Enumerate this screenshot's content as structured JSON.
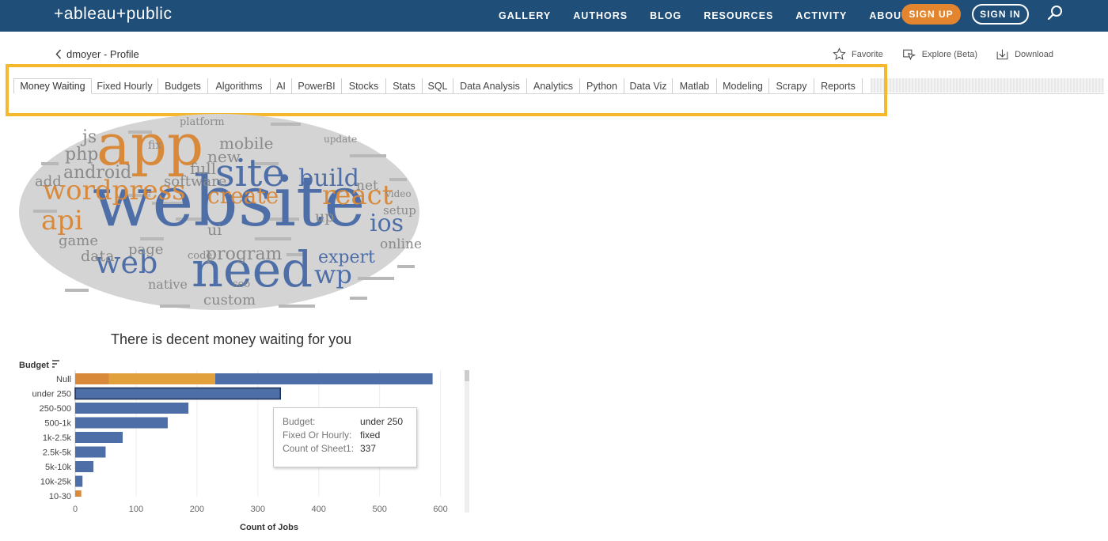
{
  "nav": {
    "logo": "+ableau+public",
    "links": [
      "GALLERY",
      "AUTHORS",
      "BLOG",
      "RESOURCES",
      "ACTIVITY",
      "ABOUT"
    ],
    "signup": "SIGN UP",
    "signin": "SIGN IN",
    "search_icon": "search-icon"
  },
  "profile": {
    "back_label": "dmoyer - Profile",
    "actions": [
      {
        "label": "Favorite",
        "icon": "star-icon"
      },
      {
        "label": "Explore (Beta)",
        "icon": "explore-icon"
      },
      {
        "label": "Download",
        "icon": "download-icon"
      }
    ]
  },
  "tabs": [
    "Money Waiting",
    "Fixed Hourly",
    "Budgets",
    "Algorithms",
    "AI",
    "PowerBI",
    "Stocks",
    "Stats",
    "SQL",
    "Data Analysis",
    "Analytics",
    "Python",
    "Data Viz",
    "Matlab",
    "Modeling",
    "Scrapy",
    "Reports"
  ],
  "active_tab": "Money Waiting",
  "colors": {
    "nav_bg": "#1f4e79",
    "accent": "#e2852e",
    "highlight": "#f5b82e",
    "bar_blue": "#4e6ea7",
    "bar_orange": "#d8893a"
  },
  "wordcloud": {
    "words": [
      {
        "text": "website",
        "color": "blue",
        "weight": 1.0
      },
      {
        "text": "app",
        "color": "orange",
        "weight": 0.95
      },
      {
        "text": "need",
        "color": "blue",
        "weight": 0.85
      },
      {
        "text": "site",
        "color": "blue",
        "weight": 0.7
      },
      {
        "text": "wordpress",
        "color": "orange",
        "weight": 0.55
      },
      {
        "text": "react",
        "color": "orange",
        "weight": 0.5
      },
      {
        "text": "build",
        "color": "blue",
        "weight": 0.5
      },
      {
        "text": "create",
        "color": "orange",
        "weight": 0.45
      },
      {
        "text": "web",
        "color": "blue",
        "weight": 0.55
      },
      {
        "text": "api",
        "color": "orange",
        "weight": 0.5
      },
      {
        "text": "ios",
        "color": "blue",
        "weight": 0.45
      },
      {
        "text": "wp",
        "color": "blue",
        "weight": 0.45
      },
      {
        "text": "android",
        "color": "gray",
        "weight": 0.35
      },
      {
        "text": "expert",
        "color": "blue",
        "weight": 0.35
      },
      {
        "text": "program",
        "color": "gray",
        "weight": 0.35
      },
      {
        "text": "mobile",
        "color": "gray",
        "weight": 0.3
      },
      {
        "text": "php",
        "color": "gray",
        "weight": 0.3
      },
      {
        "text": "custom",
        "color": "gray",
        "weight": 0.3
      },
      {
        "text": "full",
        "color": "gray",
        "weight": 0.28
      },
      {
        "text": "new",
        "color": "gray",
        "weight": 0.28
      },
      {
        "text": "add",
        "color": "gray",
        "weight": 0.25
      },
      {
        "text": "data",
        "color": "gray",
        "weight": 0.25
      },
      {
        "text": "page",
        "color": "gray",
        "weight": 0.25
      },
      {
        "text": "native",
        "color": "gray",
        "weight": 0.22
      },
      {
        "text": "game",
        "color": "gray",
        "weight": 0.22
      },
      {
        "text": "online",
        "color": "gray",
        "weight": 0.22
      },
      {
        "text": "setup",
        "color": "gray",
        "weight": 0.2
      },
      {
        "text": "software",
        "color": "gray",
        "weight": 0.25
      },
      {
        "text": "net",
        "color": "gray",
        "weight": 0.22
      },
      {
        "text": "up",
        "color": "gray",
        "weight": 0.22
      },
      {
        "text": "js",
        "color": "gray",
        "weight": 0.28
      },
      {
        "text": "ui",
        "color": "gray",
        "weight": 0.22
      },
      {
        "text": "seo",
        "color": "gray",
        "weight": 0.18
      },
      {
        "text": "platform",
        "color": "gray",
        "weight": 0.18
      },
      {
        "text": "code",
        "color": "gray",
        "weight": 0.18
      },
      {
        "text": "fix",
        "color": "gray",
        "weight": 0.18
      },
      {
        "text": "update",
        "color": "gray",
        "weight": 0.16
      },
      {
        "text": "video",
        "color": "gray",
        "weight": 0.16
      }
    ]
  },
  "chart_data": {
    "type": "bar",
    "orientation": "horizontal",
    "title": "There is decent money waiting for you",
    "ylabel": "Budget",
    "xlabel": "Count of Jobs",
    "categories": [
      "Null",
      "under 250",
      "250-500",
      "500-1k",
      "1k-2.5k",
      "2.5k-5k",
      "5k-10k",
      "10k-25k",
      "10-30"
    ],
    "series": [
      {
        "name": "hourly",
        "color": "#d8893a",
        "values": [
          230,
          0,
          0,
          0,
          0,
          0,
          0,
          0,
          10
        ]
      },
      {
        "name": "fixed",
        "color": "#4e6ea7",
        "values": [
          357,
          337,
          186,
          152,
          78,
          50,
          30,
          12,
          0
        ]
      }
    ],
    "xticks": [
      0,
      100,
      200,
      300,
      400,
      500,
      600
    ],
    "xlim": [
      0,
      620
    ],
    "grid": true,
    "tooltip": {
      "rows": [
        {
          "key": "Budget:",
          "value": "under 250"
        },
        {
          "key": "Fixed Or Hourly:",
          "value": "fixed"
        },
        {
          "key": "Count of Sheet1:",
          "value": "337"
        }
      ]
    }
  }
}
